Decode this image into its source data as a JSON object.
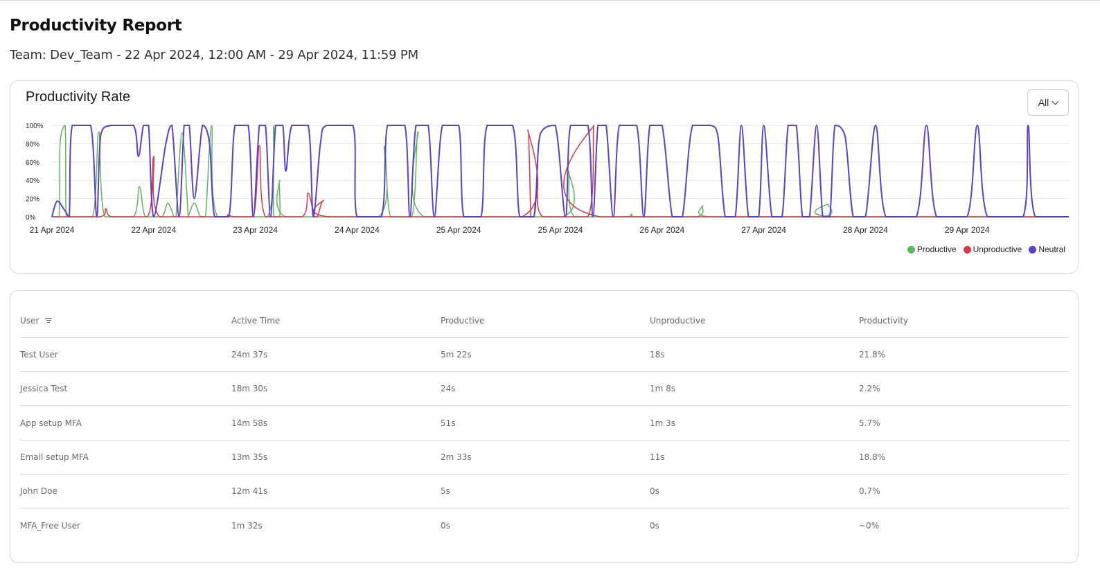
{
  "page": {
    "title": "Productivity Report",
    "subtitle": "Team: Dev_Team - 22 Apr 2024, 12:00 AM - 29 Apr 2024, 11:59 PM"
  },
  "chart_card": {
    "filter": {
      "selected": "All",
      "icon": "chevron-down-icon"
    }
  },
  "chart_data": {
    "type": "line",
    "title": "Productivity Rate",
    "ylim": [
      0,
      100
    ],
    "y_ticks": [
      "0%",
      "20%",
      "40%",
      "60%",
      "80%",
      "100%"
    ],
    "x_ticks": [
      "21 Apr 2024",
      "22 Apr 2024",
      "23 Apr 2024",
      "24 Apr 2024",
      "25 Apr 2024",
      "25 Apr 2024",
      "26 Apr 2024",
      "27 Apr 2024",
      "28 Apr 2024",
      "29 Apr 2024"
    ],
    "x_range": [
      0,
      10
    ],
    "grid": true,
    "legend_position": "bottom-right",
    "series": [
      {
        "name": "Productive",
        "color": "#5cb85c",
        "peaks": [
          [
            0.08,
            80
          ],
          [
            0.13,
            100
          ],
          [
            0.46,
            93
          ],
          [
            0.86,
            33
          ],
          [
            1.14,
            15
          ],
          [
            1.28,
            92
          ],
          [
            1.4,
            15
          ],
          [
            1.57,
            100
          ],
          [
            2.18,
            100
          ],
          [
            2.24,
            40
          ],
          [
            3.27,
            77
          ],
          [
            3.6,
            93
          ],
          [
            5.08,
            50
          ],
          [
            5.7,
            3
          ],
          [
            6.4,
            12
          ],
          [
            7.63,
            14
          ]
        ]
      },
      {
        "name": "Unproductive",
        "color": "#dc3545",
        "peaks": [
          [
            0.53,
            9
          ],
          [
            1.0,
            66
          ],
          [
            1.73,
            2
          ],
          [
            2.04,
            78
          ],
          [
            2.52,
            26
          ],
          [
            2.67,
            18
          ],
          [
            4.68,
            95
          ],
          [
            4.77,
            30
          ],
          [
            5.33,
            100
          ]
        ]
      },
      {
        "name": "Neutral",
        "color": "#5a3fd0",
        "points": [
          [
            0,
            0
          ],
          [
            0.05,
            17
          ],
          [
            0.12,
            8
          ],
          [
            0.17,
            0
          ],
          [
            0.2,
            100
          ],
          [
            0.38,
            100
          ],
          [
            0.44,
            0
          ],
          [
            0.48,
            90
          ],
          [
            0.58,
            100
          ],
          [
            0.8,
            100
          ],
          [
            0.85,
            66
          ],
          [
            0.9,
            100
          ],
          [
            0.95,
            100
          ],
          [
            1.0,
            0
          ],
          [
            1.12,
            80
          ],
          [
            1.18,
            100
          ],
          [
            1.25,
            0
          ],
          [
            1.3,
            100
          ],
          [
            1.35,
            100
          ],
          [
            1.4,
            20
          ],
          [
            1.48,
            100
          ],
          [
            1.55,
            80
          ],
          [
            1.6,
            0
          ],
          [
            1.74,
            0
          ],
          [
            1.8,
            100
          ],
          [
            1.93,
            100
          ],
          [
            1.98,
            0
          ],
          [
            2.04,
            100
          ],
          [
            2.1,
            100
          ],
          [
            2.15,
            0
          ],
          [
            2.2,
            100
          ],
          [
            2.27,
            100
          ],
          [
            2.3,
            50
          ],
          [
            2.36,
            100
          ],
          [
            2.52,
            100
          ],
          [
            2.57,
            0
          ],
          [
            2.64,
            80
          ],
          [
            2.7,
            100
          ],
          [
            2.96,
            100
          ],
          [
            3.0,
            0
          ],
          [
            3.24,
            0
          ],
          [
            3.3,
            100
          ],
          [
            3.47,
            100
          ],
          [
            3.52,
            0
          ],
          [
            3.58,
            100
          ],
          [
            3.7,
            100
          ],
          [
            3.76,
            0
          ],
          [
            3.84,
            100
          ],
          [
            4.0,
            100
          ],
          [
            4.05,
            0
          ],
          [
            4.22,
            0
          ],
          [
            4.28,
            100
          ],
          [
            4.53,
            100
          ],
          [
            4.6,
            0
          ],
          [
            4.74,
            0
          ],
          [
            4.8,
            90
          ],
          [
            4.95,
            100
          ],
          [
            5.05,
            0
          ],
          [
            5.1,
            100
          ],
          [
            5.27,
            100
          ],
          [
            5.32,
            0
          ],
          [
            5.37,
            100
          ],
          [
            5.45,
            100
          ],
          [
            5.52,
            0
          ],
          [
            5.58,
            100
          ],
          [
            5.75,
            100
          ],
          [
            5.82,
            0
          ],
          [
            5.88,
            100
          ],
          [
            6.0,
            100
          ],
          [
            6.1,
            0
          ],
          [
            6.2,
            0
          ],
          [
            6.3,
            100
          ],
          [
            6.48,
            100
          ],
          [
            6.55,
            88
          ],
          [
            6.62,
            0
          ],
          [
            6.72,
            0
          ],
          [
            6.78,
            100
          ],
          [
            6.85,
            0
          ],
          [
            6.95,
            0
          ],
          [
            7.0,
            100
          ],
          [
            7.08,
            0
          ],
          [
            7.18,
            0
          ],
          [
            7.24,
            100
          ],
          [
            7.32,
            100
          ],
          [
            7.38,
            0
          ],
          [
            7.45,
            0
          ],
          [
            7.52,
            100
          ],
          [
            7.58,
            0
          ],
          [
            7.65,
            0
          ],
          [
            7.7,
            100
          ],
          [
            7.8,
            88
          ],
          [
            7.88,
            0
          ],
          [
            8.0,
            0
          ],
          [
            8.1,
            100
          ],
          [
            8.2,
            0
          ],
          [
            8.5,
            0
          ],
          [
            8.6,
            100
          ],
          [
            8.7,
            0
          ],
          [
            9.0,
            0
          ],
          [
            9.1,
            100
          ],
          [
            9.2,
            0
          ],
          [
            9.55,
            0
          ],
          [
            9.6,
            100
          ],
          [
            9.67,
            0
          ],
          [
            10,
            0
          ]
        ]
      }
    ]
  },
  "table": {
    "headers": [
      "User",
      "Active Time",
      "Productive",
      "Unproductive",
      "Productivity"
    ],
    "user_header_icon": "filter-icon",
    "rows": [
      [
        "Test User",
        "24m 37s",
        "5m 22s",
        "18s",
        "21.8%"
      ],
      [
        "Jessica Test",
        "18m 30s",
        "24s",
        "1m 8s",
        "2.2%"
      ],
      [
        "App setup MFA",
        "14m 58s",
        "51s",
        "1m 3s",
        "5.7%"
      ],
      [
        "Email setup MFA",
        "13m 35s",
        "2m 33s",
        "11s",
        "18.8%"
      ],
      [
        "John Doe",
        "12m 41s",
        "5s",
        "0s",
        "0.7%"
      ],
      [
        "MFA_Free User",
        "1m 32s",
        "0s",
        "0s",
        "~0%"
      ]
    ]
  }
}
